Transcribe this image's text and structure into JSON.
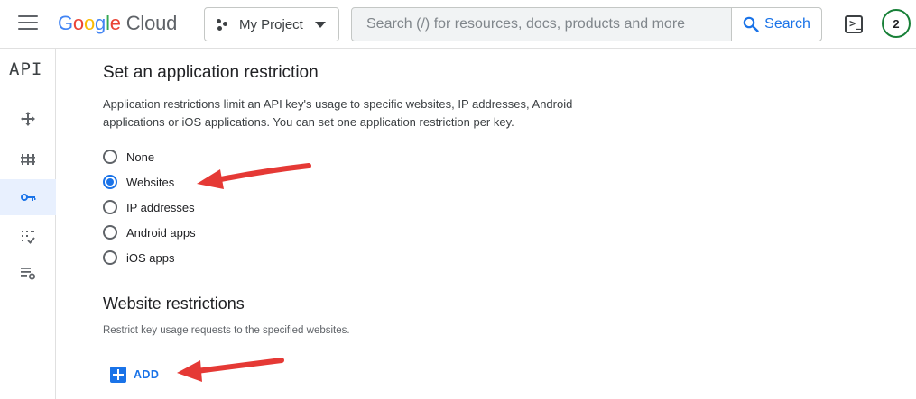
{
  "header": {
    "logo_letters": [
      "G",
      "o",
      "o",
      "g",
      "l",
      "e"
    ],
    "logo_suffix": "Cloud",
    "project_name": "My Project",
    "search_placeholder": "Search (/) for resources, docs, products and more",
    "search_button_label": "Search",
    "avatar_initial": "2"
  },
  "rail": {
    "title": "API",
    "items": [
      {
        "icon": "move-icon"
      },
      {
        "icon": "library-icon"
      },
      {
        "icon": "key-icon",
        "active": true
      },
      {
        "icon": "oauth-consent-icon"
      },
      {
        "icon": "settings-list-icon"
      }
    ]
  },
  "content": {
    "title": "Set an application restriction",
    "description": "Application restrictions limit an API key's usage to specific websites, IP addresses, Android applications or iOS applications. You can set one application restriction per key.",
    "options": [
      {
        "label": "None",
        "selected": false
      },
      {
        "label": "Websites",
        "selected": true
      },
      {
        "label": "IP addresses",
        "selected": false
      },
      {
        "label": "Android apps",
        "selected": false
      },
      {
        "label": "iOS apps",
        "selected": false
      }
    ],
    "website_title": "Website restrictions",
    "website_description": "Restrict key usage requests to the specified websites.",
    "add_label": "ADD"
  },
  "colors": {
    "accent": "#1a73e8",
    "annotation_arrow": "#e53935"
  }
}
